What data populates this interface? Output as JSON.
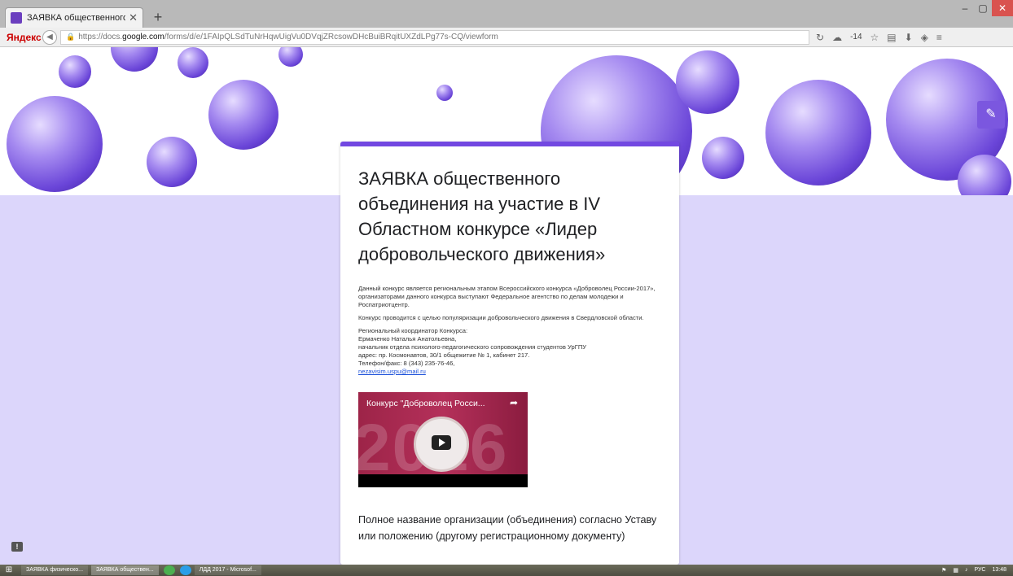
{
  "browser": {
    "tab_title": "ЗАЯВКА общественного ...",
    "tab_close": "✕",
    "new_tab": "+",
    "window_buttons": [
      "–",
      "▢",
      "✕"
    ],
    "yandex_logo": "Яндекс",
    "url_prefix": "https://docs.",
    "url_domain": "google.com",
    "url_path": "/forms/d/e/1FAIpQLSdTuNrHqwUigVu0DVqjZRcsowDHcBuiBRqitUXZdLPg77s-CQ/viewform",
    "weather_badge": "-14"
  },
  "form": {
    "title": "ЗАЯВКА общественного объединения на участие в IV Областном конкурсе «Лидер добровольческого движения»",
    "desc_p1": "Данный конкурс является региональным этапом Всероссийского конкурса «Доброволец России-2017», организаторами данного конкурса выступают Федеральное агентство по делам молодежи и Роспатриотцентр.",
    "desc_p2": "Конкурс проводится с целью популяризации добровольческого движения в Свердловской области.",
    "contact": {
      "line1": "Региональный координатор Конкурса:",
      "line2": "Ермаченко Наталья Анатольевна,",
      "line3": "начальник отдела психолого-педагогического сопровождения студентов УрГПУ",
      "line4": "адрес: пр. Космонавтов, 30/1 общежитие № 1, кабинет 217.",
      "line5": "Телефон/факс: 8 (343) 235-76-46,",
      "email": "nezavisim.uspu@mail.ru"
    },
    "video_title": "Конкурс \"Доброволец Росси...",
    "video_year": "2016",
    "question": "Полное название организации (объединения) согласно Уставу или положению (другому регистрационному документу)"
  },
  "taskbar": {
    "apps": [
      "ЗАЯВКА физическо...",
      "ЗАЯВКА обществен...",
      "ЛДД 2017 - Microsof..."
    ],
    "lang": "РУС",
    "time": "13:48"
  },
  "colors": {
    "accent": "#7248e1",
    "background": "#dcd6fb"
  }
}
